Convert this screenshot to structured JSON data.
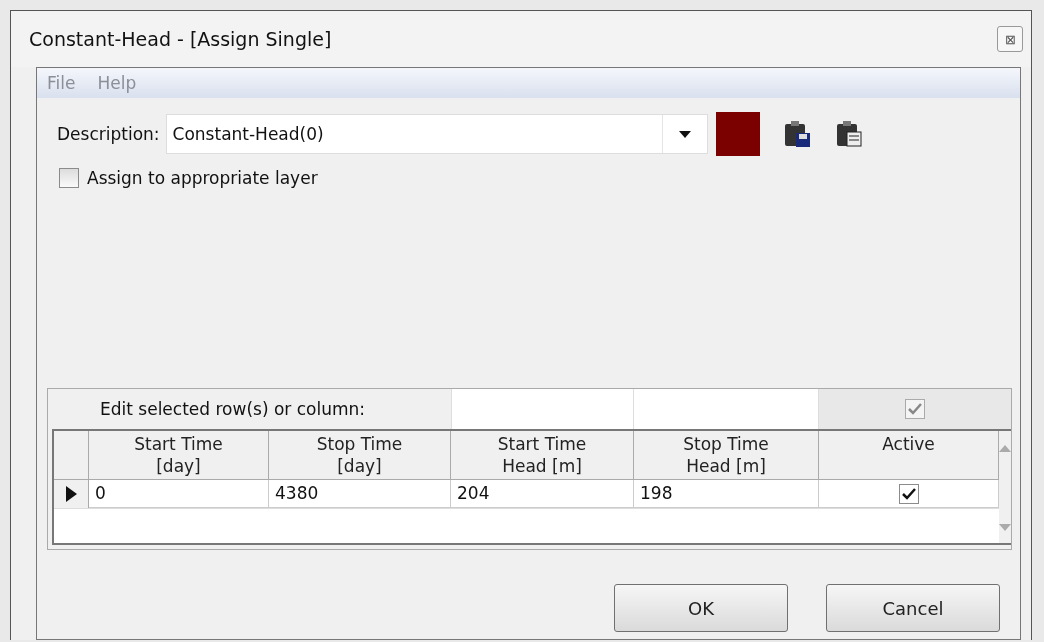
{
  "window": {
    "title": "Constant-Head - [Assign Single]",
    "close": "⊠"
  },
  "menu": [
    "File",
    "Help"
  ],
  "description": {
    "label": "Description:",
    "value": "Constant-Head(0)",
    "color": "#7b0000"
  },
  "assign_layer": {
    "label": "Assign to appropriate layer",
    "checked": false
  },
  "edit_row": {
    "label": "Edit selected row(s) or column:",
    "active_checked": true
  },
  "table": {
    "columns": [
      "Start Time\n[day]",
      "Stop Time\n[day]",
      "Start Time\nHead [m]",
      "Stop Time\nHead [m]",
      "Active"
    ],
    "rows": [
      {
        "selected": true,
        "cells": [
          "0",
          "4380",
          "204",
          "198"
        ],
        "active": true
      }
    ]
  },
  "buttons": [
    "OK",
    "Cancel"
  ]
}
